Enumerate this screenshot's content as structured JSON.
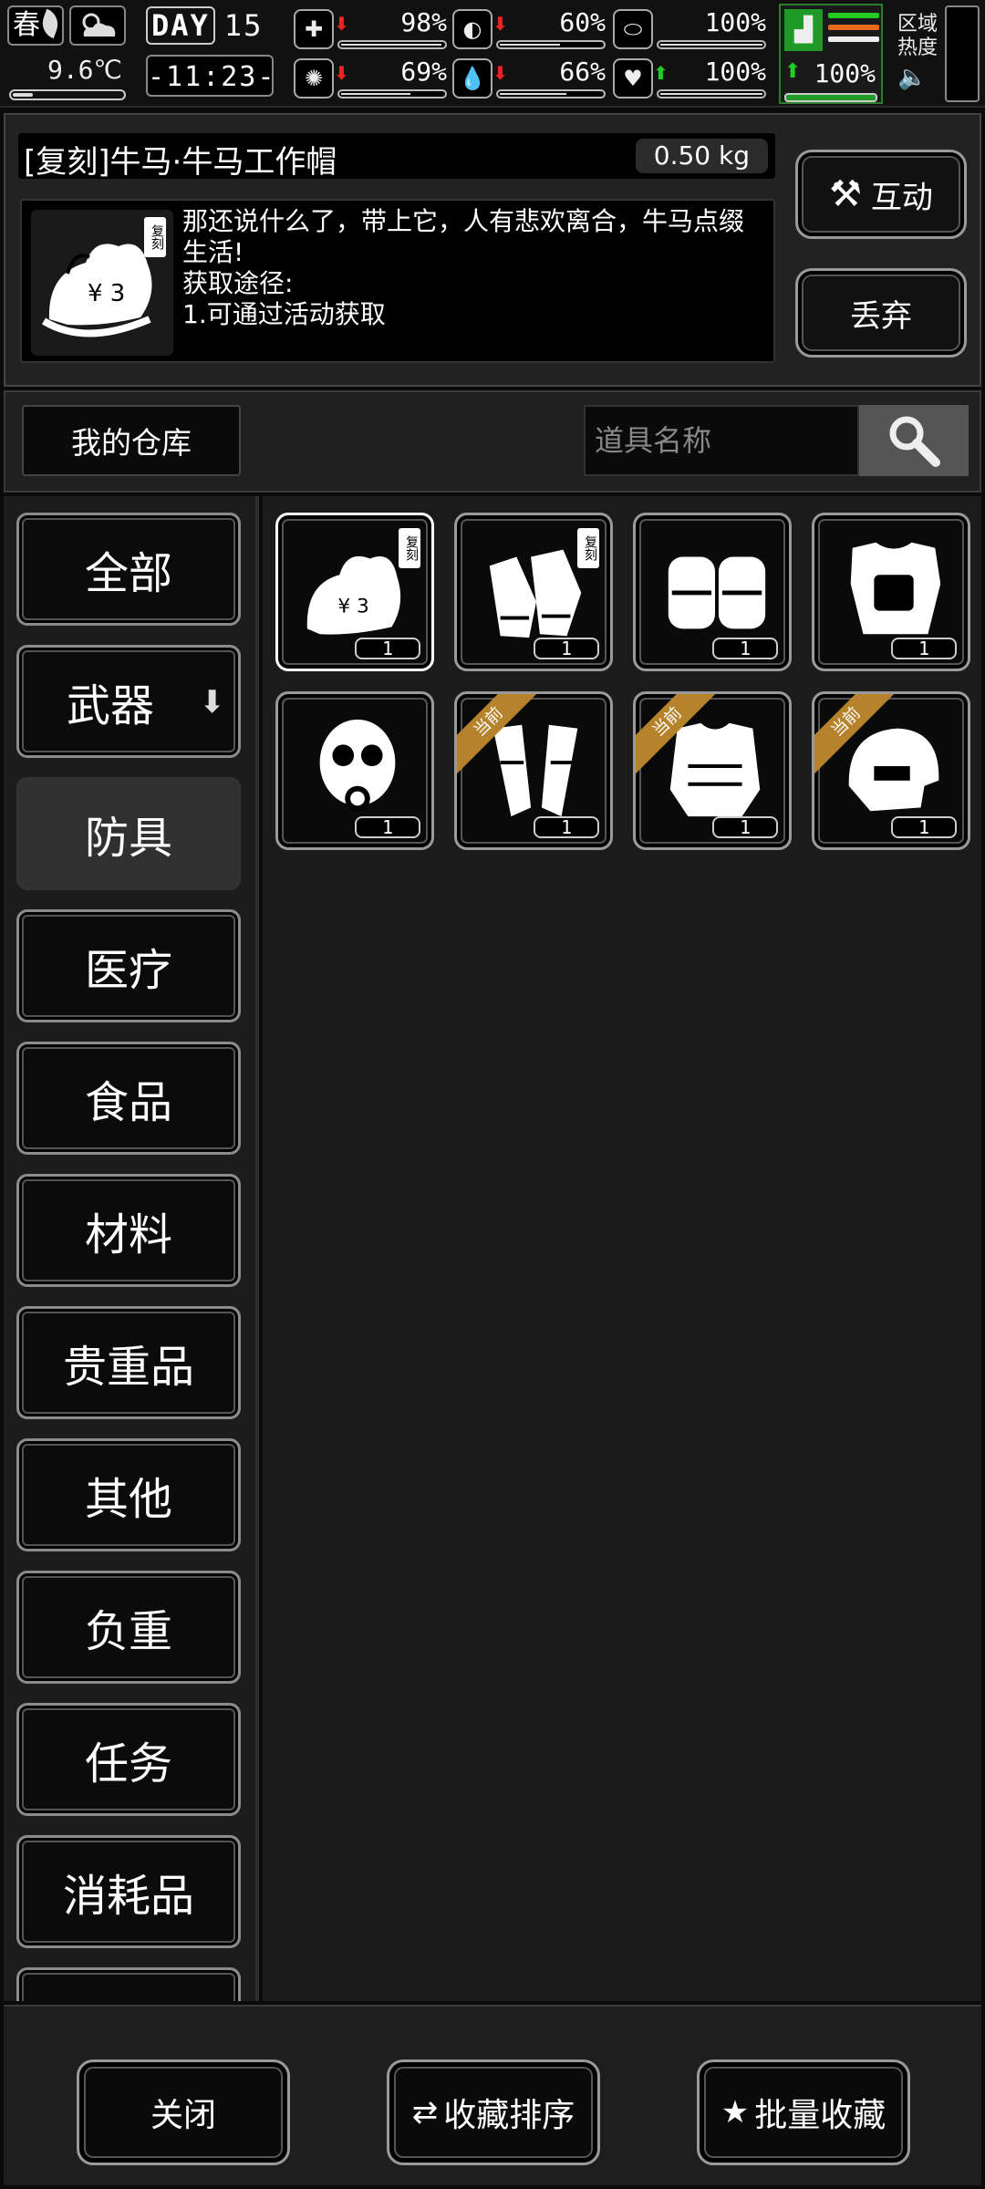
{
  "status": {
    "season": "春",
    "temperature": "9.6℃",
    "day_label": "DAY",
    "day_number": "15",
    "clock": "-11:23-",
    "stats": [
      {
        "icon": "medkit-icon",
        "trend": "down",
        "value": "98%",
        "level": 0.98
      },
      {
        "icon": "stomach-icon",
        "trend": "down",
        "value": "60%",
        "level": 0.6
      },
      {
        "icon": "pill-icon",
        "trend": "none",
        "value": "100%",
        "level": 1.0
      },
      {
        "icon": "brain-icon",
        "trend": "down",
        "value": "69%",
        "level": 0.69
      },
      {
        "icon": "water-drop-icon",
        "trend": "down",
        "value": "66%",
        "level": 0.66
      },
      {
        "icon": "heart-icon",
        "trend": "up",
        "value": "100%",
        "level": 1.0
      }
    ],
    "stamina": {
      "icon": "boot-icon",
      "trend": "up",
      "value": "100%",
      "level": 1.0
    },
    "area_heat": "区域热度"
  },
  "detail": {
    "item_name": "[复刻]牛马·牛马工作帽",
    "weight": "0.50 kg",
    "description": "那还说什么了，带上它，人有悲欢离合，牛马点缀生活!\n获取途径:\n1.可通过活动获取",
    "thumb_tag": "复刻",
    "interact_label": "互动",
    "discard_label": "丢弃"
  },
  "warehouse": {
    "label": "我的仓库",
    "search_placeholder": "道具名称"
  },
  "categories": [
    "全部",
    "武器",
    "防具",
    "医疗",
    "食品",
    "材料",
    "贵重品",
    "其他",
    "负重",
    "任务",
    "消耗品"
  ],
  "active_category": "防具",
  "items": [
    {
      "name": "horse-work-hat",
      "count": "1",
      "tag": "复刻",
      "ribbon": ""
    },
    {
      "name": "work-gloves",
      "count": "1",
      "tag": "复刻",
      "ribbon": ""
    },
    {
      "name": "knee-pads",
      "count": "1",
      "tag": "",
      "ribbon": ""
    },
    {
      "name": "tactical-vest",
      "count": "1",
      "tag": "",
      "ribbon": ""
    },
    {
      "name": "gas-mask",
      "count": "1",
      "tag": "",
      "ribbon": ""
    },
    {
      "name": "shin-guards",
      "count": "1",
      "tag": "",
      "ribbon": "当前"
    },
    {
      "name": "body-armor",
      "count": "1",
      "tag": "",
      "ribbon": "当前"
    },
    {
      "name": "tactical-helmet",
      "count": "1",
      "tag": "",
      "ribbon": "当前"
    }
  ],
  "bottom": {
    "close_label": "关闭",
    "sort_label": "收藏排序",
    "batch_label": "批量收藏"
  }
}
